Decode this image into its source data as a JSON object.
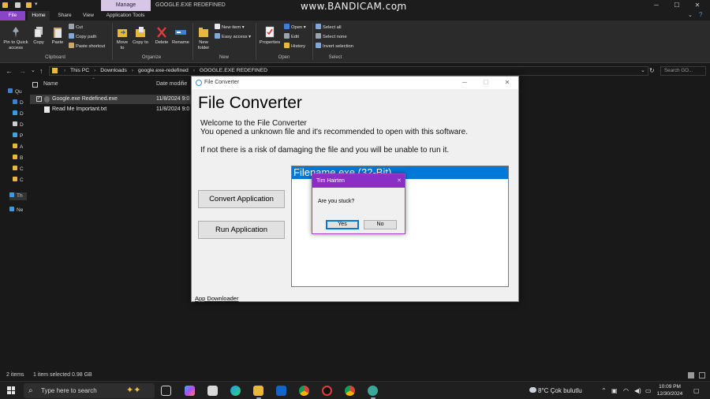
{
  "titlebar": {
    "context_tab": "Manage",
    "window_title": "GOOGLE.EXE REDEFINED",
    "watermark": "www.BANDICAM.com",
    "minimize": "─",
    "maximize": "☐",
    "close": "✕"
  },
  "ribbon_tabs": {
    "file": "File",
    "home": "Home",
    "share": "Share",
    "view": "View",
    "app_tools": "Application Tools"
  },
  "ribbon": {
    "clipboard": {
      "pin": "Pin to Quick access",
      "copy": "Copy",
      "paste": "Paste",
      "cut": "Cut",
      "copy_path": "Copy path",
      "paste_shortcut": "Paste shortcut",
      "label": "Clipboard"
    },
    "organize": {
      "move_to": "Move to",
      "copy_to": "Copy to",
      "delete": "Delete",
      "rename": "Rename",
      "label": "Organize"
    },
    "new": {
      "new_folder": "New folder",
      "new_item": "New item",
      "easy_access": "Easy access",
      "label": "New"
    },
    "open": {
      "properties": "Properties",
      "open": "Open",
      "edit": "Edit",
      "history": "History",
      "label": "Open"
    },
    "select": {
      "select_all": "Select all",
      "select_none": "Select none",
      "invert": "Invert selection",
      "label": "Select"
    }
  },
  "address": {
    "crumbs": [
      "This PC",
      "Downloads",
      "google.exe-redefined",
      "GOOGLE.EXE REDEFINED"
    ],
    "search_placeholder": "Search GO..."
  },
  "navpane": {
    "items": [
      "Qu",
      "D",
      "D",
      "D",
      "P",
      "A",
      "B",
      "C",
      "C",
      "Th",
      "Ne"
    ]
  },
  "filelist": {
    "col_name": "Name",
    "col_date": "Date modifie",
    "rows": [
      {
        "name": "Google.exe Redefined.exe",
        "date": "11/8/2024 9:0",
        "selected": true
      },
      {
        "name": "Read Me Important.txt",
        "date": "11/8/2024 9:0",
        "selected": false
      }
    ]
  },
  "statusbar": {
    "items": "2 items",
    "selected": "1 item selected  0.98 GB"
  },
  "fc": {
    "window_title": "File Converter",
    "heading": "File Converter",
    "line1": "Welcome to the File Converter",
    "line2": "You opened a unknown file and it's recommended to open with this software.",
    "line3": "If not there is a risk of damaging the file and you will be unable to run it.",
    "convert_btn": "Convert Application",
    "run_btn": "Run Application",
    "list_item": "Filename.exe (32-Bit)",
    "link": "App Downloader",
    "minimize": "─",
    "maximize": "☐",
    "close": "✕"
  },
  "dialog": {
    "title": "Tim Hairten",
    "close": "✕",
    "message": "Are you stuck?",
    "yes": "Yes",
    "no": "No"
  },
  "taskbar": {
    "search_placeholder": "Type here to search",
    "weather": "8°C  Çok bulutlu",
    "time": "10:09 PM",
    "date": "12/30/2024"
  },
  "colors": {
    "accent_purple": "#8a45c6",
    "dialog_title": "#8a2fc6",
    "selection_blue": "#0078d7"
  }
}
